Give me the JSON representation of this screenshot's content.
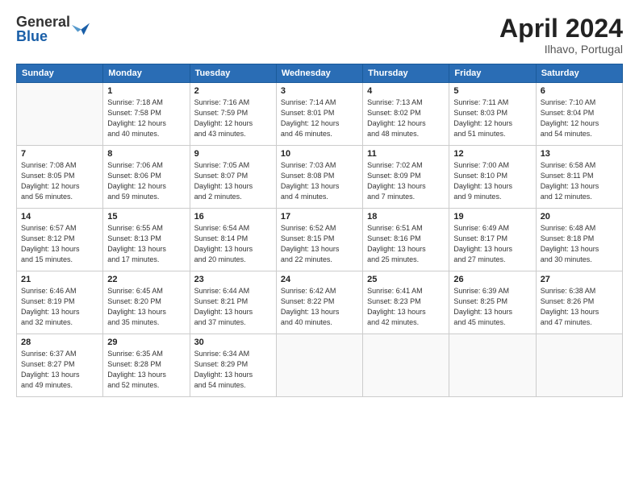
{
  "header": {
    "logo_general": "General",
    "logo_blue": "Blue",
    "title": "April 2024",
    "location": "Ilhavo, Portugal"
  },
  "days_of_week": [
    "Sunday",
    "Monday",
    "Tuesday",
    "Wednesday",
    "Thursday",
    "Friday",
    "Saturday"
  ],
  "weeks": [
    [
      {
        "day": "",
        "info": ""
      },
      {
        "day": "1",
        "info": "Sunrise: 7:18 AM\nSunset: 7:58 PM\nDaylight: 12 hours\nand 40 minutes."
      },
      {
        "day": "2",
        "info": "Sunrise: 7:16 AM\nSunset: 7:59 PM\nDaylight: 12 hours\nand 43 minutes."
      },
      {
        "day": "3",
        "info": "Sunrise: 7:14 AM\nSunset: 8:01 PM\nDaylight: 12 hours\nand 46 minutes."
      },
      {
        "day": "4",
        "info": "Sunrise: 7:13 AM\nSunset: 8:02 PM\nDaylight: 12 hours\nand 48 minutes."
      },
      {
        "day": "5",
        "info": "Sunrise: 7:11 AM\nSunset: 8:03 PM\nDaylight: 12 hours\nand 51 minutes."
      },
      {
        "day": "6",
        "info": "Sunrise: 7:10 AM\nSunset: 8:04 PM\nDaylight: 12 hours\nand 54 minutes."
      }
    ],
    [
      {
        "day": "7",
        "info": "Sunrise: 7:08 AM\nSunset: 8:05 PM\nDaylight: 12 hours\nand 56 minutes."
      },
      {
        "day": "8",
        "info": "Sunrise: 7:06 AM\nSunset: 8:06 PM\nDaylight: 12 hours\nand 59 minutes."
      },
      {
        "day": "9",
        "info": "Sunrise: 7:05 AM\nSunset: 8:07 PM\nDaylight: 13 hours\nand 2 minutes."
      },
      {
        "day": "10",
        "info": "Sunrise: 7:03 AM\nSunset: 8:08 PM\nDaylight: 13 hours\nand 4 minutes."
      },
      {
        "day": "11",
        "info": "Sunrise: 7:02 AM\nSunset: 8:09 PM\nDaylight: 13 hours\nand 7 minutes."
      },
      {
        "day": "12",
        "info": "Sunrise: 7:00 AM\nSunset: 8:10 PM\nDaylight: 13 hours\nand 9 minutes."
      },
      {
        "day": "13",
        "info": "Sunrise: 6:58 AM\nSunset: 8:11 PM\nDaylight: 13 hours\nand 12 minutes."
      }
    ],
    [
      {
        "day": "14",
        "info": "Sunrise: 6:57 AM\nSunset: 8:12 PM\nDaylight: 13 hours\nand 15 minutes."
      },
      {
        "day": "15",
        "info": "Sunrise: 6:55 AM\nSunset: 8:13 PM\nDaylight: 13 hours\nand 17 minutes."
      },
      {
        "day": "16",
        "info": "Sunrise: 6:54 AM\nSunset: 8:14 PM\nDaylight: 13 hours\nand 20 minutes."
      },
      {
        "day": "17",
        "info": "Sunrise: 6:52 AM\nSunset: 8:15 PM\nDaylight: 13 hours\nand 22 minutes."
      },
      {
        "day": "18",
        "info": "Sunrise: 6:51 AM\nSunset: 8:16 PM\nDaylight: 13 hours\nand 25 minutes."
      },
      {
        "day": "19",
        "info": "Sunrise: 6:49 AM\nSunset: 8:17 PM\nDaylight: 13 hours\nand 27 minutes."
      },
      {
        "day": "20",
        "info": "Sunrise: 6:48 AM\nSunset: 8:18 PM\nDaylight: 13 hours\nand 30 minutes."
      }
    ],
    [
      {
        "day": "21",
        "info": "Sunrise: 6:46 AM\nSunset: 8:19 PM\nDaylight: 13 hours\nand 32 minutes."
      },
      {
        "day": "22",
        "info": "Sunrise: 6:45 AM\nSunset: 8:20 PM\nDaylight: 13 hours\nand 35 minutes."
      },
      {
        "day": "23",
        "info": "Sunrise: 6:44 AM\nSunset: 8:21 PM\nDaylight: 13 hours\nand 37 minutes."
      },
      {
        "day": "24",
        "info": "Sunrise: 6:42 AM\nSunset: 8:22 PM\nDaylight: 13 hours\nand 40 minutes."
      },
      {
        "day": "25",
        "info": "Sunrise: 6:41 AM\nSunset: 8:23 PM\nDaylight: 13 hours\nand 42 minutes."
      },
      {
        "day": "26",
        "info": "Sunrise: 6:39 AM\nSunset: 8:25 PM\nDaylight: 13 hours\nand 45 minutes."
      },
      {
        "day": "27",
        "info": "Sunrise: 6:38 AM\nSunset: 8:26 PM\nDaylight: 13 hours\nand 47 minutes."
      }
    ],
    [
      {
        "day": "28",
        "info": "Sunrise: 6:37 AM\nSunset: 8:27 PM\nDaylight: 13 hours\nand 49 minutes."
      },
      {
        "day": "29",
        "info": "Sunrise: 6:35 AM\nSunset: 8:28 PM\nDaylight: 13 hours\nand 52 minutes."
      },
      {
        "day": "30",
        "info": "Sunrise: 6:34 AM\nSunset: 8:29 PM\nDaylight: 13 hours\nand 54 minutes."
      },
      {
        "day": "",
        "info": ""
      },
      {
        "day": "",
        "info": ""
      },
      {
        "day": "",
        "info": ""
      },
      {
        "day": "",
        "info": ""
      }
    ]
  ]
}
